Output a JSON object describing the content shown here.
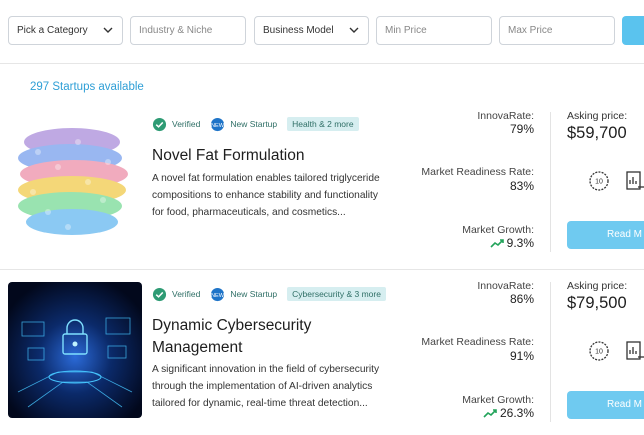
{
  "filters": {
    "category": "Pick a Category",
    "industry_placeholder": "Industry & Niche",
    "business_model": "Business Model",
    "min_price_placeholder": "Min Price",
    "max_price_placeholder": "Max Price"
  },
  "results_count": "297 Startups available",
  "colors": {
    "accent": "#5ac3ee",
    "link": "#2f9fd6",
    "badge_bg": "#d6eef0",
    "verified": "#2e9b74",
    "growth": "#22a35a"
  },
  "listings": [
    {
      "badges": {
        "verified": "Verified",
        "new": "New Startup",
        "tags": "Health & 2 more"
      },
      "title": "Novel Fat Formulation",
      "description_lines": [
        "A novel fat formulation enables tailored triglyceride",
        "compositions to enhance stability and functionality",
        "for food, pharmaceuticals, and cosmetics..."
      ],
      "innovarate_label": "InnovaRate:",
      "innovarate": "79%",
      "readiness_label": "Market Readiness Rate:",
      "readiness": "83%",
      "growth_label": "Market Growth:",
      "growth": "9.3%",
      "asking_label": "Asking price:",
      "asking_price": "$59,700",
      "read_more": "Read M"
    },
    {
      "badges": {
        "verified": "Verified",
        "new": "New Startup",
        "tags": "Cybersecurity & 3 more"
      },
      "title_lines": [
        "Dynamic Cybersecurity",
        "Management"
      ],
      "description_lines": [
        "A significant innovation in the field of cybersecurity",
        "through the implementation of AI-driven analytics",
        "tailored for dynamic, real-time threat detection..."
      ],
      "innovarate_label": "InnovaRate:",
      "innovarate": "86%",
      "readiness_label": "Market Readiness Rate:",
      "readiness": "91%",
      "growth_label": "Market Growth:",
      "growth": "26.3%",
      "asking_label": "Asking price:",
      "asking_price": "$79,500",
      "read_more": "Read M"
    }
  ]
}
